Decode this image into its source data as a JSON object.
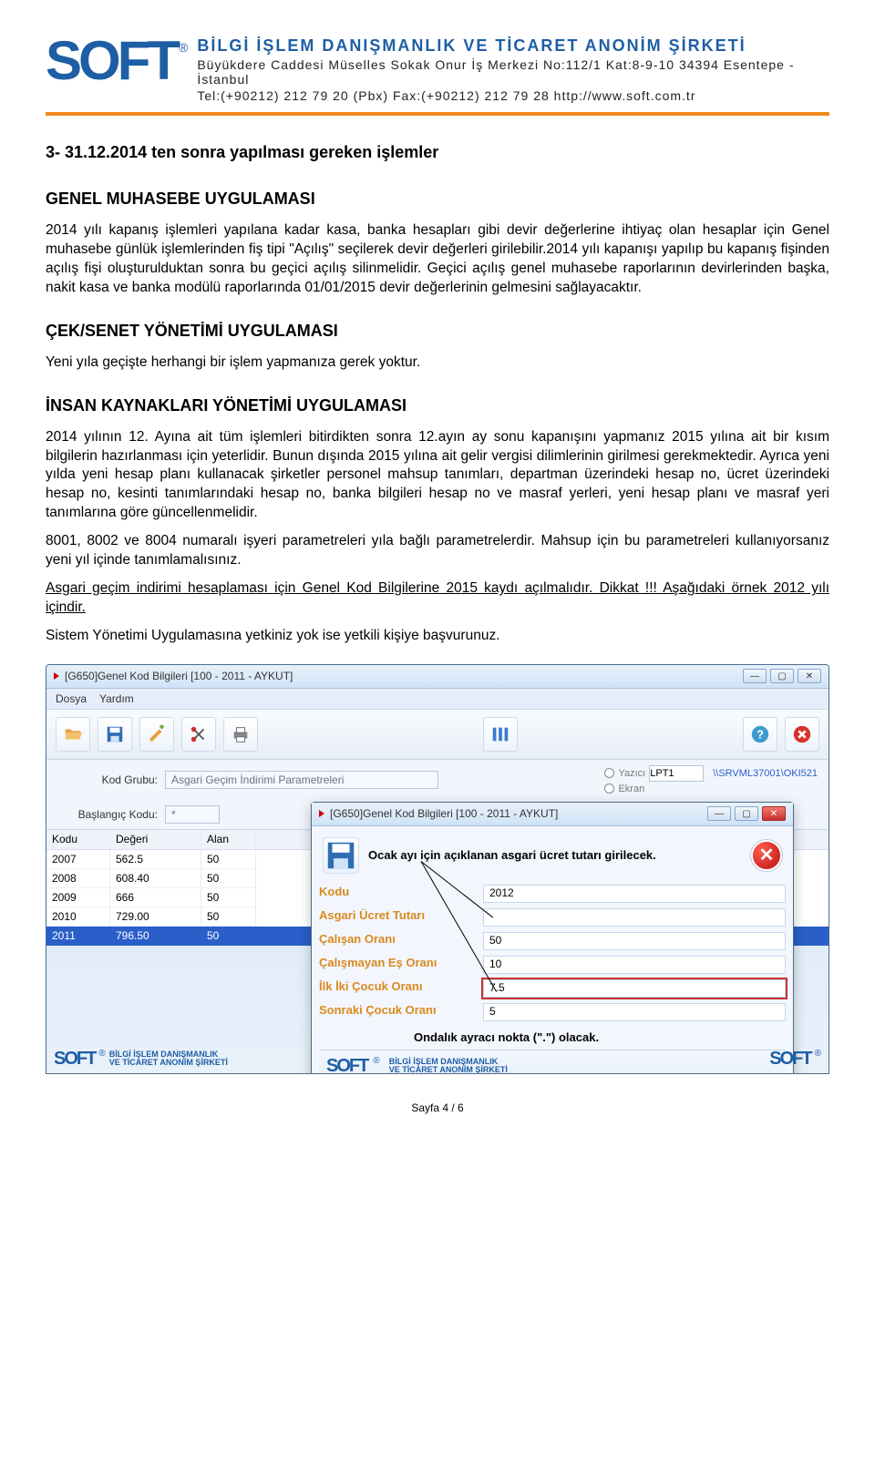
{
  "letterhead": {
    "logo_text": "SOFT",
    "reg_mark": "®",
    "company_name": "BİLGİ İŞLEM DANIŞMANLIK VE TİCARET ANONİM ŞİRKETİ",
    "address": "Büyükdere Caddesi Müselles Sokak Onur İş Merkezi No:112/1 Kat:8-9-10 34394 Esentepe - İstanbul",
    "tel_fax_url": "Tel:(+90212) 212 79 20 (Pbx)  Fax:(+90212) 212 79 28   http://www.soft.com.tr"
  },
  "doc": {
    "intro": "3-   31.12.2014 ten sonra yapılması gereken işlemler",
    "sec1_title": "GENEL MUHASEBE UYGULAMASI",
    "sec1_body": "2014 yılı kapanış işlemleri yapılana kadar kasa, banka hesapları gibi devir değerlerine ihtiyaç olan hesaplar için Genel muhasebe günlük işlemlerinden fiş tipi \"Açılış\" seçilerek devir değerleri girilebilir.2014 yılı kapanışı yapılıp bu kapanış fişinden açılış fişi oluşturulduktan sonra bu geçici açılış silinmelidir. Geçici açılış genel muhasebe raporlarının devirlerinden başka, nakit kasa ve banka modülü raporlarında 01/01/2015 devir değerlerinin gelmesini sağlayacaktır.",
    "sec2_title": "ÇEK/SENET YÖNETİMİ UYGULAMASI",
    "sec2_body": "Yeni yıla geçişte herhangi bir işlem yapmanıza gerek yoktur.",
    "sec3_title": "İNSAN KAYNAKLARI YÖNETİMİ UYGULAMASI",
    "sec3_p1": "2014 yılının 12. Ayına ait tüm işlemleri bitirdikten sonra 12.ayın ay sonu kapanışını yapmanız 2015 yılına ait bir kısım bilgilerin hazırlanması için yeterlidir. Bunun dışında 2015 yılına ait gelir vergisi dilimlerinin girilmesi gerekmektedir. Ayrıca yeni yılda yeni hesap planı kullanacak şirketler personel mahsup tanımları, departman üzerindeki hesap no, ücret üzerindeki hesap no, kesinti tanımlarındaki hesap no, banka bilgileri hesap no ve masraf yerleri, yeni hesap planı ve masraf yeri tanımlarına göre güncellenmelidir.",
    "sec3_p2": "8001, 8002 ve 8004 numaralı işyeri parametreleri yıla bağlı parametrelerdir. Mahsup için bu parametreleri kullanıyorsanız yeni yıl içinde tanımlamalısınız.",
    "sec3_u1": "Asgari geçim indirimi hesaplaması için Genel Kod Bilgilerine 2015 kaydı açılmalıdır. Dikkat !!! Aşağıdaki örnek 2012 yılı içindir.",
    "sec3_p3": "Sistem Yönetimi Uygulamasına yetkiniz yok ise yetkili kişiye başvurunuz."
  },
  "app_outer": {
    "title": "[G650]Genel Kod Bilgileri [100 - 2011 - AYKUT]",
    "menu": [
      "Dosya",
      "Yardım"
    ],
    "form": {
      "kod_grubu_label": "Kod Grubu:",
      "kod_grubu_value": "Asgari Geçim İndirimi Parametreleri",
      "baslangic_label": "Başlangıç Kodu:",
      "baslangic_value": "*",
      "radio1": "Yazıcı",
      "radio2": "Ekran",
      "lpt_label": "LPT1",
      "path_label": "\\\\SRVML37001\\OKI521"
    },
    "grid_headers": [
      "Kodu",
      "Değeri",
      "Alan"
    ],
    "grid_rows": [
      {
        "kodu": "2007",
        "degeri": "562.5",
        "alan": "50"
      },
      {
        "kodu": "2008",
        "degeri": "608.40",
        "alan": "50"
      },
      {
        "kodu": "2009",
        "degeri": "666",
        "alan": "50"
      },
      {
        "kodu": "2010",
        "degeri": "729.00",
        "alan": "50"
      },
      {
        "kodu": "2011",
        "degeri": "796.50",
        "alan": "50"
      }
    ]
  },
  "app_inner": {
    "title": "[G650]Genel Kod Bilgileri [100 - 2011 - AYKUT]",
    "save_note": "Ocak ayı için açıklanan asgari ücret tutarı girilecek.",
    "fields": {
      "kodu_label": "Kodu",
      "kodu_value": "2012",
      "asgari_label": "Asgari Ücret Tutarı",
      "asgari_value": "",
      "calisan_label": "Çalışan Oranı",
      "calisan_value": "50",
      "calismayan_label": "Çalışmayan Eş Oranı",
      "calismayan_value": "10",
      "ilkiki_label": "İlk İki Çocuk Oranı",
      "ilkiki_value": "7.5",
      "sonraki_label": "Sonraki Çocuk Oranı",
      "sonraki_value": "5"
    },
    "annotation2": "Ondalık ayracı nokta (\".\") olacak."
  },
  "footers": {
    "soft": "SOFT",
    "reg": "®",
    "tag_line1": "BİLGİ İŞLEM DANIŞMANLIK",
    "tag_line2": "VE TİCARET ANONİM ŞİRKETİ"
  },
  "page_number": "Sayfa 4 / 6"
}
